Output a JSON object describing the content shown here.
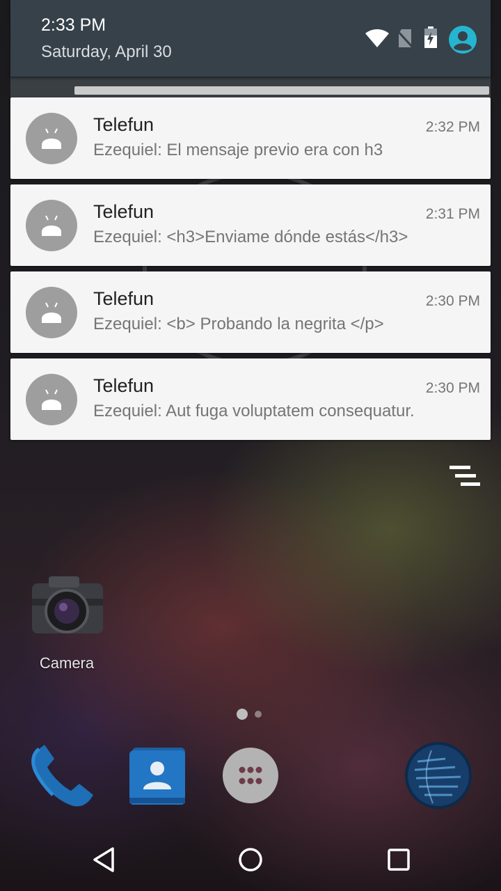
{
  "shade": {
    "time": "2:33 PM",
    "date": "Saturday, April 30"
  },
  "status_icons": [
    "wifi-icon",
    "no-sim-icon",
    "battery-charging-icon",
    "user-icon"
  ],
  "colors": {
    "shade_header": "#37414a",
    "notification_bg": "#f5f5f5",
    "avatar": "#9e9e9e",
    "user_icon_accent": "#26b5d1"
  },
  "notifications": [
    {
      "app": "Telefun",
      "time": "2:32 PM",
      "text": "Ezequiel: El mensaje previo era con h3"
    },
    {
      "app": "Telefun",
      "time": "2:31 PM",
      "text": "Ezequiel: <h3>Enviame dónde estás</h3>"
    },
    {
      "app": "Telefun",
      "time": "2:30 PM",
      "text": "Ezequiel: <b> Probando la negrita </p>"
    },
    {
      "app": "Telefun",
      "time": "2:30 PM",
      "text": "Ezequiel: Aut fuga voluptatem consequatur."
    }
  ],
  "home": {
    "camera_label": "Camera",
    "dock": [
      "phone-icon",
      "contacts-icon",
      "app-drawer-icon",
      "browser-globe-icon"
    ]
  },
  "nav": [
    "back-icon",
    "home-icon",
    "recents-icon"
  ]
}
